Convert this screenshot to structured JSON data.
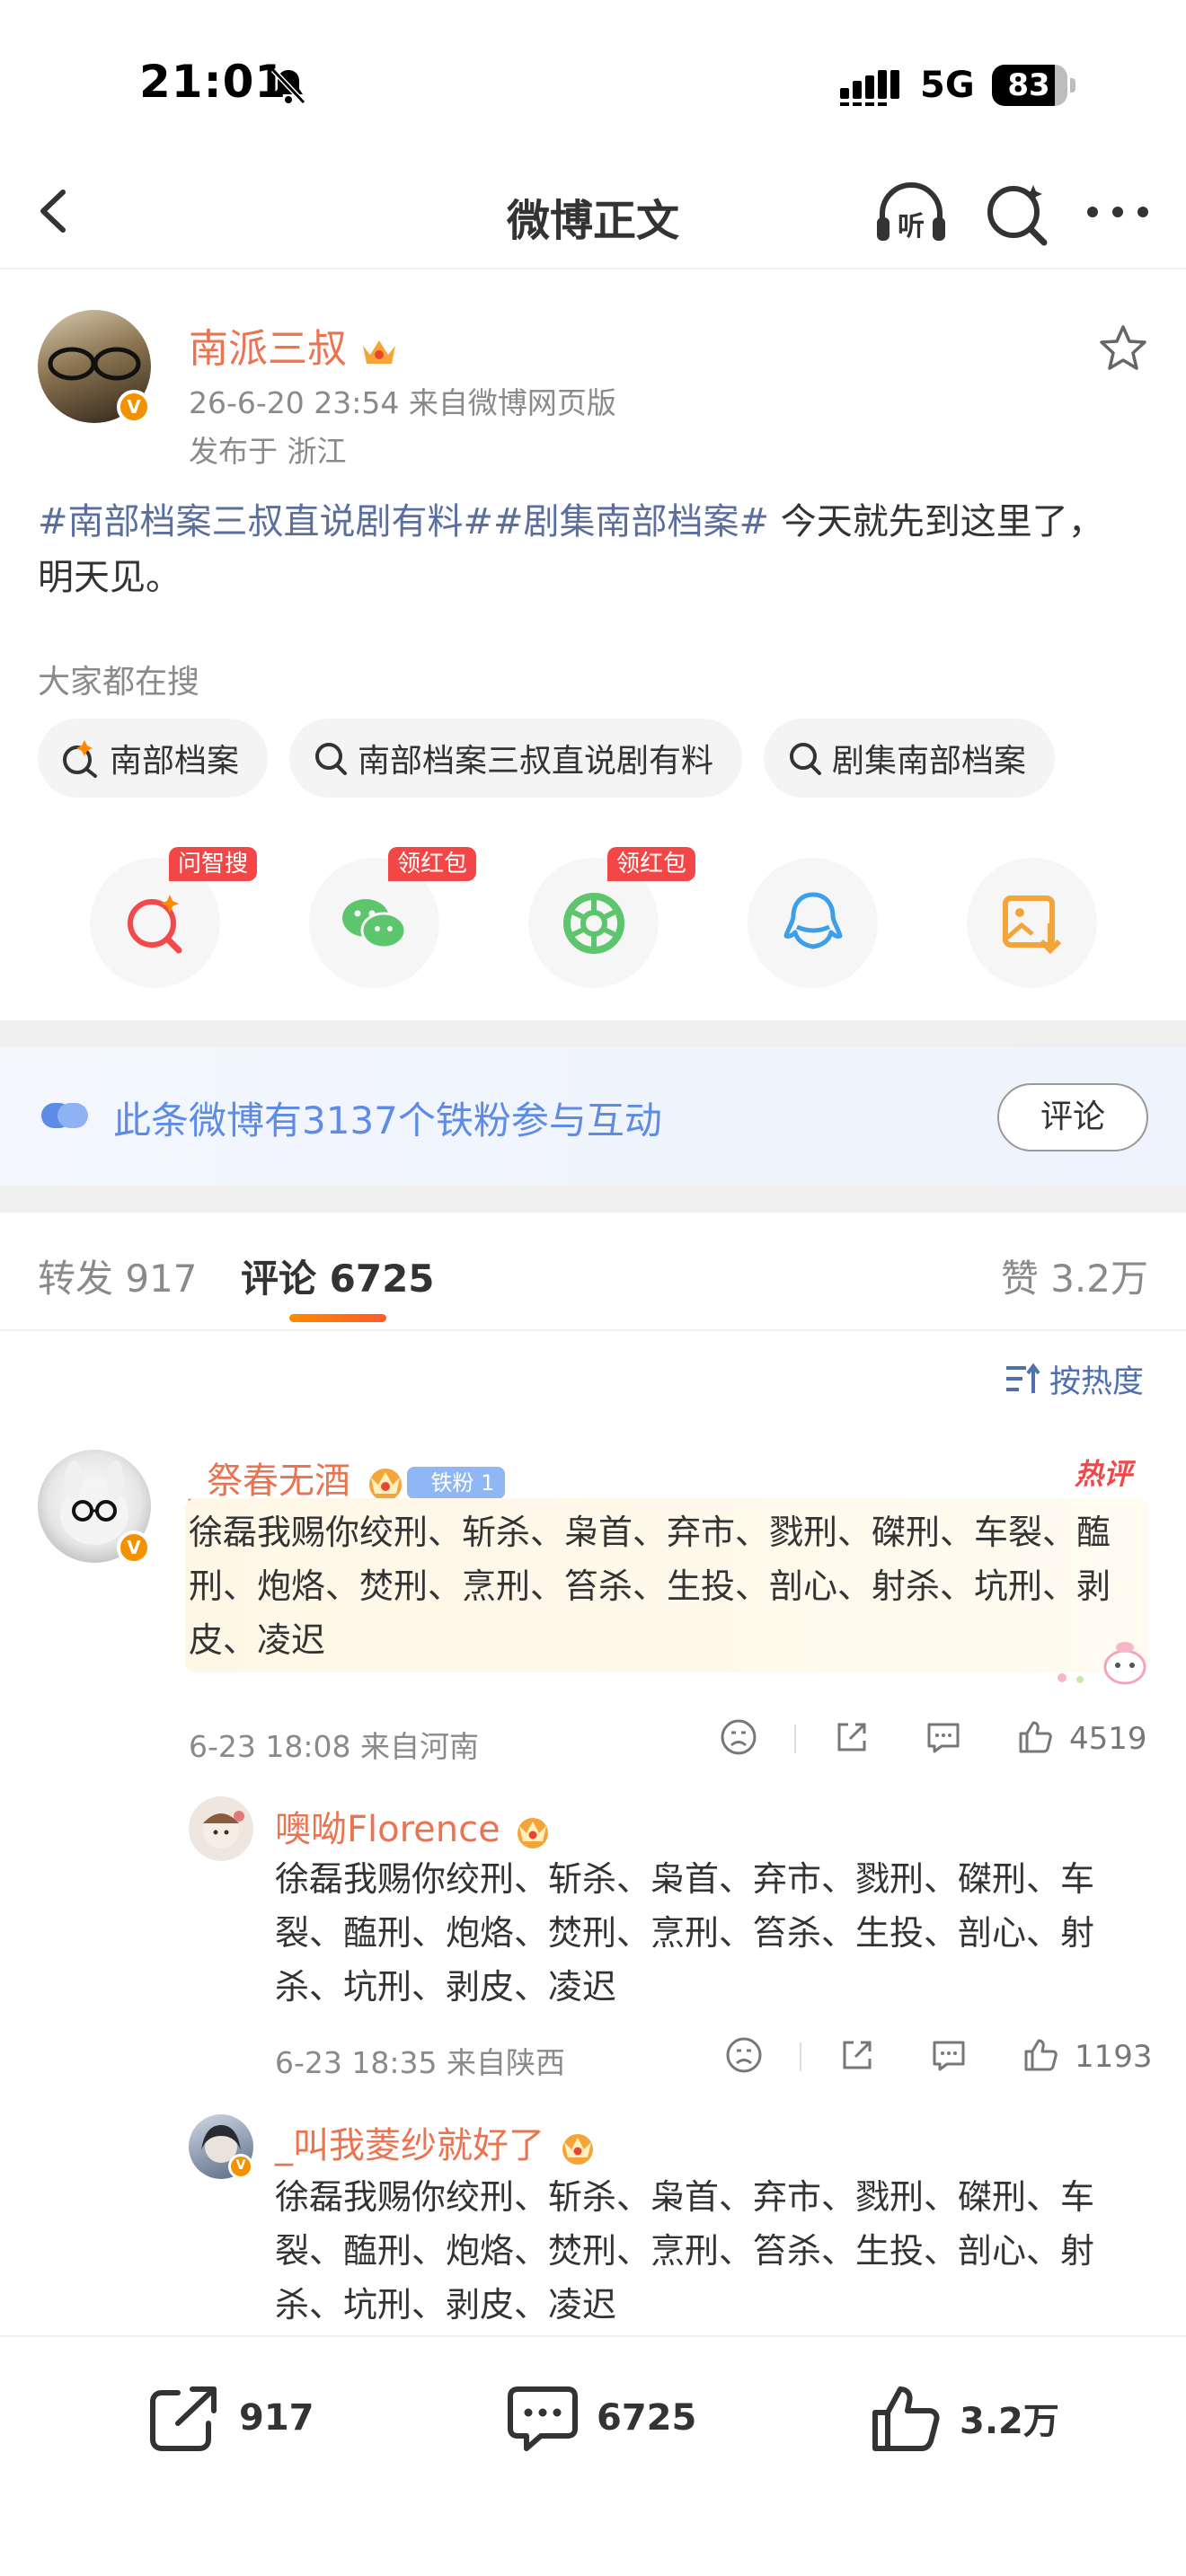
{
  "status": {
    "time": "21:01",
    "network": "5G",
    "battery": "83"
  },
  "nav": {
    "title": "微博正文",
    "listen_label": "听"
  },
  "post": {
    "author": "南派三叔",
    "meta": "26-6-20 23:54  来自微博网页版",
    "location": "发布于 浙江",
    "topic": "#南部档案三叔直说剧有料##剧集南部档案#",
    "text_line1": " 今天就先到这里了，",
    "text_line2": "明天见。"
  },
  "search": {
    "heading": "大家都在搜",
    "chips": [
      "南部档案",
      "南部档案三叔直说剧有料",
      "剧集南部档案"
    ]
  },
  "share": {
    "tags": [
      "问智搜",
      "领红包",
      "领红包"
    ]
  },
  "fans": {
    "text": "此条微博有3137个铁粉参与互动",
    "button": "评论"
  },
  "tabs": {
    "repost": "转发 917",
    "comment": "评论 6725",
    "likes": "赞 3.2万"
  },
  "sort_label": "按热度",
  "comments": [
    {
      "name": "_祭春无酒",
      "fan_badge": "铁粉 1",
      "hot": "热评",
      "text": [
        "徐磊我赐你绞刑、斩杀、枭首、弃市、戮刑、磔刑、车裂、醢",
        "刑、炮烙、焚刑、烹刑、笞杀、生投、剖心、射杀、坑刑、剥",
        "皮、凌迟"
      ],
      "meta": "6-23 18:08  来自河南",
      "likes": "4519"
    }
  ],
  "replies": [
    {
      "name": "噢呦Florence",
      "text": [
        "徐磊我赐你绞刑、斩杀、枭首、弃市、戮刑、磔刑、车",
        "裂、醢刑、炮烙、焚刑、烹刑、笞杀、生投、剖心、射",
        "杀、坑刑、剥皮、凌迟"
      ],
      "meta": "6-23 18:35  来自陕西",
      "likes": "1193"
    },
    {
      "name": "_叫我菱纱就好了",
      "text": [
        "徐磊我赐你绞刑、斩杀、枭首、弃市、戮刑、磔刑、车",
        "裂、醢刑、炮烙、焚刑、烹刑、笞杀、生投、剖心、射",
        "杀、坑刑、剥皮、凌迟"
      ]
    }
  ],
  "bottom_bar": {
    "repost": "917",
    "comment": "6725",
    "like": "3.2万"
  },
  "colors": {
    "accent": "#eb7350",
    "topic": "#5b6f9e",
    "fans_blue": "#5d8be6",
    "hot_red": "#f04848"
  }
}
